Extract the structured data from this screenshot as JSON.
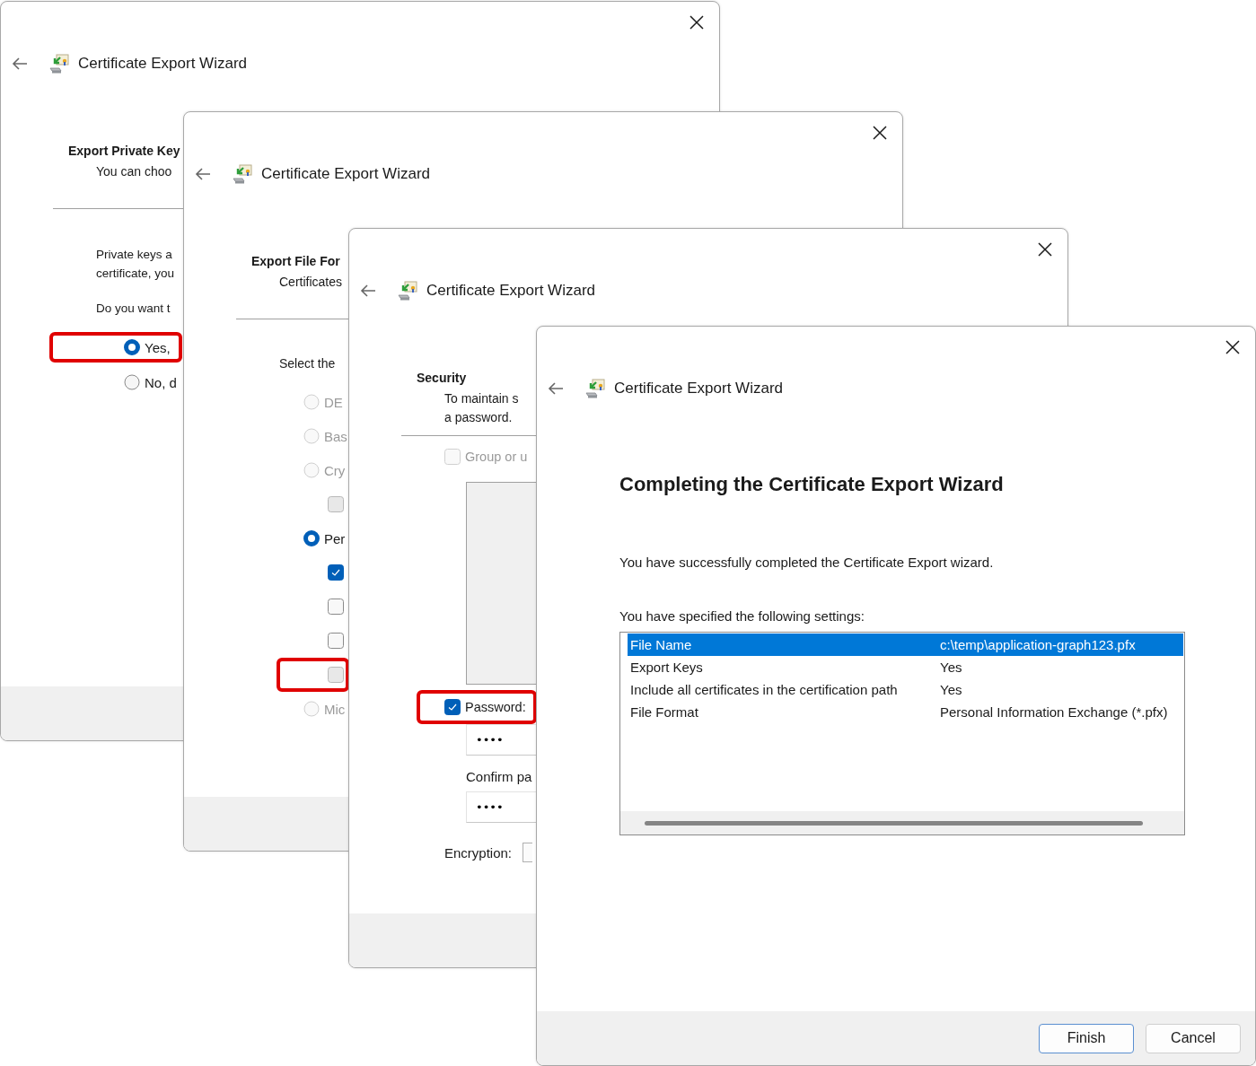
{
  "windows": [
    {
      "kind": "private_key",
      "title": "Certificate Export Wizard",
      "heading": "Export Private Key",
      "subtitle_lines": [
        "You can choo"
      ],
      "paragraph_lines": [
        "Private keys a",
        "certificate, you"
      ],
      "question": "Do you want t",
      "options": [
        {
          "label": "Yes,",
          "selected": true,
          "highlighted": true
        },
        {
          "label": "No, d",
          "selected": false,
          "highlighted": false
        }
      ]
    },
    {
      "kind": "file_format",
      "title": "Certificate Export Wizard",
      "heading": "Export File For",
      "subtitle_lines": [
        "Certificates"
      ],
      "prompt": "Select the",
      "options": [
        {
          "label": "DE",
          "selected": false,
          "disabled": true,
          "highlighted": false
        },
        {
          "label": "Bas",
          "selected": false,
          "disabled": true,
          "highlighted": false
        },
        {
          "label": "Cry",
          "selected": false,
          "disabled": true,
          "highlighted": false,
          "children": [
            {
              "checked": false,
              "disabled": true,
              "highlighted": false
            }
          ]
        },
        {
          "label": "Per",
          "selected": true,
          "disabled": false,
          "highlighted": false,
          "children": [
            {
              "checked": true,
              "disabled": false,
              "highlighted": false
            },
            {
              "checked": false,
              "disabled": false,
              "highlighted": false
            },
            {
              "checked": false,
              "disabled": false,
              "highlighted": false
            },
            {
              "checked": false,
              "disabled": true,
              "highlighted": true
            }
          ]
        },
        {
          "label": "Mic",
          "selected": false,
          "disabled": true,
          "highlighted": false
        }
      ]
    },
    {
      "kind": "security",
      "title": "Certificate Export Wizard",
      "heading": "Security",
      "subtitle_lines": [
        "To maintain s",
        "a password."
      ],
      "group_checkbox": {
        "label": "Group or u",
        "checked": false,
        "disabled": true
      },
      "password": {
        "label": "Password:",
        "checked": true,
        "highlighted": true,
        "value": "••••"
      },
      "confirm": {
        "label": "Confirm pa",
        "value": "••••"
      },
      "encryption_label": "Encryption:"
    },
    {
      "kind": "completing",
      "title": "Certificate Export Wizard",
      "heading": "Completing the Certificate Export Wizard",
      "message": "You have successfully completed the Certificate Export wizard.",
      "settings_label": "You have specified the following settings:",
      "settings": [
        {
          "name": "File Name",
          "value": "c:\\temp\\application-graph123.pfx",
          "selected": true
        },
        {
          "name": "Export Keys",
          "value": "Yes",
          "selected": false
        },
        {
          "name": "Include all certificates in the certification path",
          "value": "Yes",
          "selected": false
        },
        {
          "name": "File Format",
          "value": "Personal Information Exchange (*.pfx)",
          "selected": false
        }
      ],
      "buttons": [
        {
          "label": "Finish",
          "default": true
        },
        {
          "label": "Cancel",
          "default": false
        }
      ]
    }
  ]
}
